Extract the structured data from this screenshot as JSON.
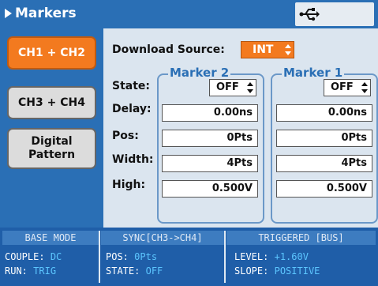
{
  "title_bar": {
    "title": "Markers",
    "usb_icon": "usb-icon"
  },
  "sidebar": {
    "buttons": [
      {
        "label": "CH1 + CH2",
        "active": true
      },
      {
        "label": "CH3 + CH4",
        "active": false
      },
      {
        "label": "Digital Pattern",
        "active": false
      }
    ]
  },
  "main": {
    "download_source_label": "Download Source:",
    "download_source_value": "INT",
    "row_labels": {
      "state": "State:",
      "delay": "Delay:",
      "pos": "Pos:",
      "width": "Width:",
      "high": "High:"
    },
    "marker2": {
      "title": "Marker 2",
      "state": "OFF",
      "delay": "0.00ns",
      "pos": "0Pts",
      "width": "4Pts",
      "high": "0.500V"
    },
    "marker1": {
      "title": "Marker 1",
      "state": "OFF",
      "delay": "0.00ns",
      "pos": "0Pts",
      "width": "4Pts",
      "high": "0.500V"
    }
  },
  "status": {
    "base_mode": {
      "header": "BASE MODE",
      "couple_key": "COUPLE:",
      "couple_val": "DC",
      "run_key": "RUN:",
      "run_val": "TRIG"
    },
    "sync": {
      "header": "SYNC[CH3->CH4]",
      "pos_key": "POS:",
      "pos_val": "0Pts",
      "state_key": "STATE:",
      "state_val": "OFF"
    },
    "triggered": {
      "header": "TRIGGERED [BUS]",
      "level_key": "LEVEL:",
      "level_val": "+1.60V",
      "slope_key": "SLOPE:",
      "slope_val": "POSITIVE"
    }
  },
  "colors": {
    "title_blue": "#2a6fb5",
    "accent_orange": "#f37a1f",
    "status_value": "#5cc6ff"
  }
}
